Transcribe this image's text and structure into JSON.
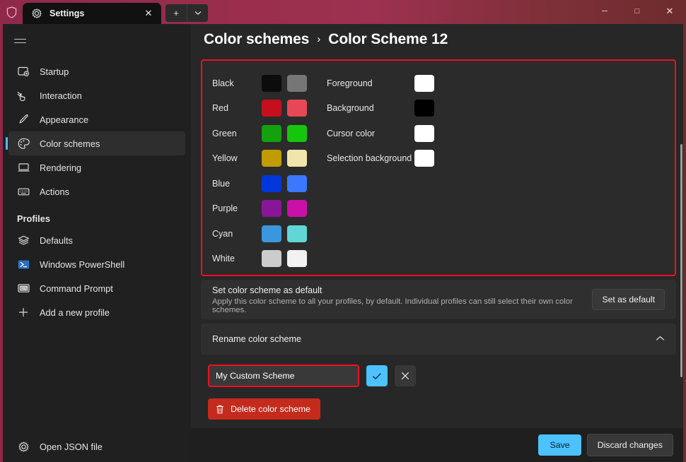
{
  "window": {
    "shield_icon": "shield-icon",
    "tab": {
      "icon": "gear-icon",
      "title": "Settings",
      "close_icon": "close-icon"
    },
    "new_tab_label": "+",
    "dropdown_label": "⌄",
    "minimize_label": "─",
    "maximize_label": "□",
    "close_label": "✕"
  },
  "sidebar": {
    "menu_icon": "hamburger-icon",
    "items": [
      {
        "label": "Startup",
        "icon": "startup-icon",
        "selected": false
      },
      {
        "label": "Interaction",
        "icon": "interaction-icon",
        "selected": false
      },
      {
        "label": "Appearance",
        "icon": "brush-icon",
        "selected": false
      },
      {
        "label": "Color schemes",
        "icon": "palette-icon",
        "selected": true
      },
      {
        "label": "Rendering",
        "icon": "monitor-icon",
        "selected": false
      },
      {
        "label": "Actions",
        "icon": "keyboard-icon",
        "selected": false
      }
    ],
    "section_label": "Profiles",
    "profiles": [
      {
        "label": "Defaults",
        "icon": "layers-icon"
      },
      {
        "label": "Windows PowerShell",
        "icon": "powershell-icon"
      },
      {
        "label": "Command Prompt",
        "icon": "cmd-icon"
      },
      {
        "label": "Add a new profile",
        "icon": "plus-icon"
      }
    ],
    "footer": {
      "label": "Open JSON file",
      "icon": "gear-icon"
    }
  },
  "header": {
    "breadcrumb_root": "Color schemes",
    "breadcrumb_separator": "›",
    "breadcrumb_current": "Color Scheme 12"
  },
  "colors": {
    "highlight_color": "#ee1122",
    "rows": [
      {
        "name": "Black",
        "normal": "#0c0c0c",
        "bright": "#767676"
      },
      {
        "name": "Red",
        "normal": "#c50f1f",
        "bright": "#e74856"
      },
      {
        "name": "Green",
        "normal": "#13a10e",
        "bright": "#16c60c"
      },
      {
        "name": "Yellow",
        "normal": "#c19c00",
        "bright": "#f2e5ac"
      },
      {
        "name": "Blue",
        "normal": "#0037da",
        "bright": "#3b78ff"
      },
      {
        "name": "Purple",
        "normal": "#881798",
        "bright": "#c910a8"
      },
      {
        "name": "Cyan",
        "normal": "#3a96dd",
        "bright": "#61d6d6"
      },
      {
        "name": "White",
        "normal": "#cccccc",
        "bright": "#f2f2f2"
      }
    ],
    "system": [
      {
        "name": "Foreground",
        "value": "#ffffff"
      },
      {
        "name": "Background",
        "value": "#000000"
      },
      {
        "name": "Cursor color",
        "value": "#ffffff"
      },
      {
        "name": "Selection background",
        "value": "#ffffff"
      }
    ]
  },
  "set_default": {
    "title": "Set color scheme as default",
    "subtitle": "Apply this color scheme to all your profiles, by default. Individual profiles can still select their own color schemes.",
    "button_label": "Set as default"
  },
  "rename": {
    "header_label": "Rename color scheme",
    "expander_icon": "chevron-up-icon",
    "input_value": "My Custom Scheme",
    "input_placeholder": "",
    "accept_icon": "checkmark-icon",
    "cancel_icon": "close-icon"
  },
  "delete": {
    "label": "Delete color scheme",
    "icon": "trash-icon",
    "color": "#c42b1c"
  },
  "footer": {
    "save_label": "Save",
    "discard_label": "Discard changes",
    "accent_color": "#4cc2ff"
  }
}
